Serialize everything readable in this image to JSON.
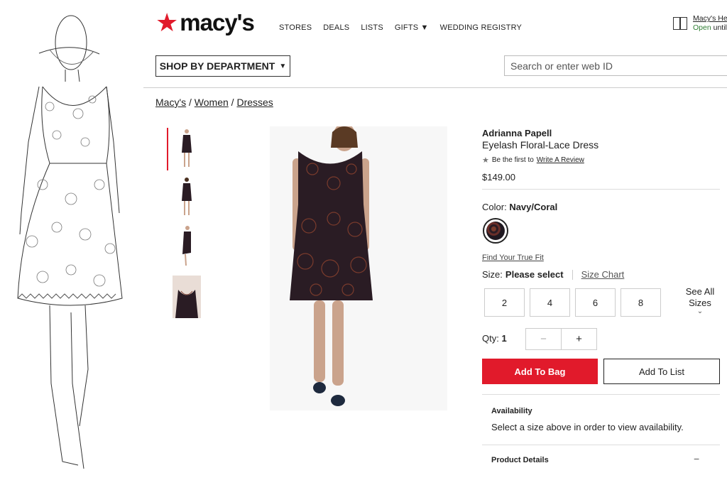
{
  "header": {
    "logo_text": "macy's",
    "nav": [
      "STORES",
      "DEALS",
      "LISTS",
      "GIFTS ▼",
      "WEDDING REGISTRY"
    ],
    "store_link": "Macy's He",
    "store_status_open": "Open",
    "store_status_rest": " until",
    "shop_by_department": "SHOP BY DEPARTMENT",
    "search_placeholder": "Search or enter web ID"
  },
  "breadcrumb": [
    "Macy's",
    "Women",
    "Dresses"
  ],
  "product": {
    "brand": "Adrianna Papell",
    "name": "Eyelash Floral-Lace Dress",
    "review_prompt": "Be the first to",
    "review_link": "Write A Review",
    "price": "$149.00",
    "color_label": "Color:",
    "color_value": "Navy/Coral",
    "fit_link": "Find Your True Fit",
    "size_label": "Size:",
    "size_value": "Please select",
    "size_chart": "Size Chart",
    "sizes": [
      "2",
      "4",
      "6",
      "8"
    ],
    "see_all_line1": "See All",
    "see_all_line2": "Sizes",
    "qty_label": "Qty:",
    "qty_value": "1",
    "add_to_bag": "Add To Bag",
    "add_to_list": "Add To List",
    "availability_title": "Availability",
    "availability_text": "Select a size above in order to view availability.",
    "product_details": "Product Details"
  },
  "colors": {
    "brand_red": "#e11a2b",
    "dress": "#2a1c24",
    "lace": "#7a3b2c"
  }
}
